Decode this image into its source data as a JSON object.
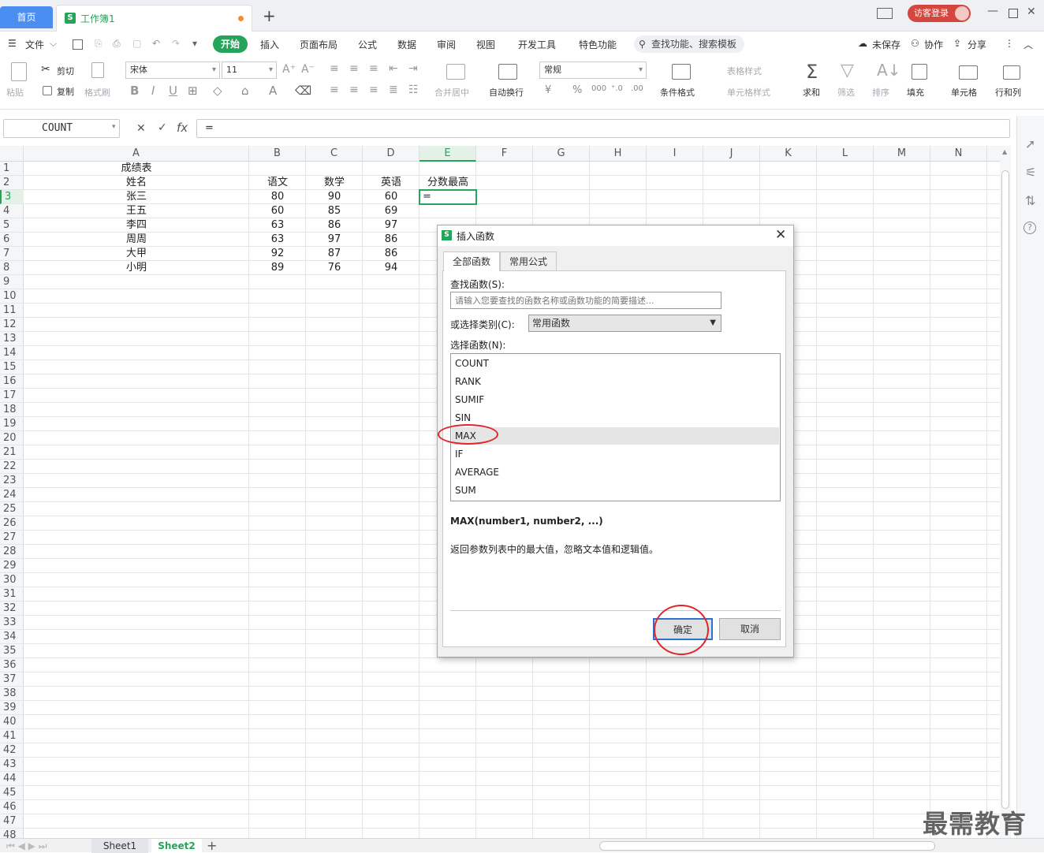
{
  "titlebar": {
    "home_tab": "首页",
    "book_tab": "工作簿1",
    "book_icon": "S",
    "login": "访客登录"
  },
  "menu": {
    "file": "文件",
    "start": "开始",
    "items": [
      "插入",
      "页面布局",
      "公式",
      "数据",
      "审阅",
      "视图",
      "开发工具",
      "特色功能"
    ],
    "search": "查找功能、搜索模板",
    "unsaved": "未保存",
    "collab": "协作",
    "share": "分享"
  },
  "ribbon": {
    "paste": "粘贴",
    "cut": "剪切",
    "copy": "复制",
    "format_painter": "格式刷",
    "font": "宋体",
    "size": "11",
    "merge": "合并居中",
    "wrap": "自动换行",
    "number_format": "常规",
    "cond_format": "条件格式",
    "table_style": "表格样式",
    "cell_style": "单元格样式",
    "sum": "求和",
    "filter": "筛选",
    "sort": "排序",
    "fill": "填充",
    "cells": "单元格",
    "rowcol": "行和列",
    "fmt_bold": "B",
    "fmt_italic": "I",
    "fmt_underline": "U",
    "font_color_letter": "A",
    "currency": "¥",
    "percent": "%"
  },
  "formula_bar": {
    "name_box": "COUNT",
    "formula": "=",
    "cancel_glyph": "✕",
    "enter_glyph": "✓",
    "fx_glyph": "fx"
  },
  "columns": [
    "A",
    "B",
    "C",
    "D",
    "E",
    "F",
    "G",
    "H",
    "I",
    "J",
    "K",
    "L",
    "M",
    "N"
  ],
  "rows": [
    "1",
    "2",
    "3",
    "4",
    "5",
    "6",
    "7",
    "8",
    "9",
    "10",
    "11",
    "12",
    "13",
    "14",
    "15",
    "16",
    "17",
    "18",
    "19",
    "20",
    "21",
    "22",
    "23",
    "24",
    "25",
    "26",
    "27",
    "28",
    "29",
    "30",
    "31",
    "32",
    "33",
    "34",
    "35",
    "36",
    "37",
    "38",
    "39",
    "40",
    "41",
    "42",
    "43",
    "44",
    "45",
    "46",
    "47",
    "48"
  ],
  "sheet": {
    "title": "成绩表",
    "headers": [
      "姓名",
      "语文",
      "数学",
      "英语",
      "分数最高"
    ],
    "data": [
      [
        "张三",
        "80",
        "90",
        "60"
      ],
      [
        "王五",
        "60",
        "85",
        "69"
      ],
      [
        "李四",
        "63",
        "86",
        "97"
      ],
      [
        "周周",
        "63",
        "97",
        "86"
      ],
      [
        "大甲",
        "92",
        "87",
        "86"
      ],
      [
        "小明",
        "89",
        "76",
        "94"
      ]
    ],
    "active_value": "="
  },
  "sheet_tabs": [
    "Sheet1",
    "Sheet2"
  ],
  "dialog": {
    "title": "插入函数",
    "icon": "S",
    "tabs": [
      "全部函数",
      "常用公式"
    ],
    "search_label": "查找函数(S):",
    "search_placeholder": "请输入您要查找的函数名称或函数功能的简要描述...",
    "category_label": "或选择类别(C):",
    "category_value": "常用函数",
    "list_label": "选择函数(N):",
    "functions": [
      "COUNT",
      "RANK",
      "SUMIF",
      "SIN",
      "MAX",
      "IF",
      "AVERAGE",
      "SUM"
    ],
    "selected": "MAX",
    "signature": "MAX(number1, number2, ...)",
    "description": "返回参数列表中的最大值，忽略文本值和逻辑值。",
    "ok": "确定",
    "cancel": "取消",
    "close_glyph": "✕"
  },
  "watermark": "最需教育",
  "colors": {
    "green": "#25a45b",
    "blue": "#4b8ef1",
    "red_mark": "#e0262b"
  }
}
